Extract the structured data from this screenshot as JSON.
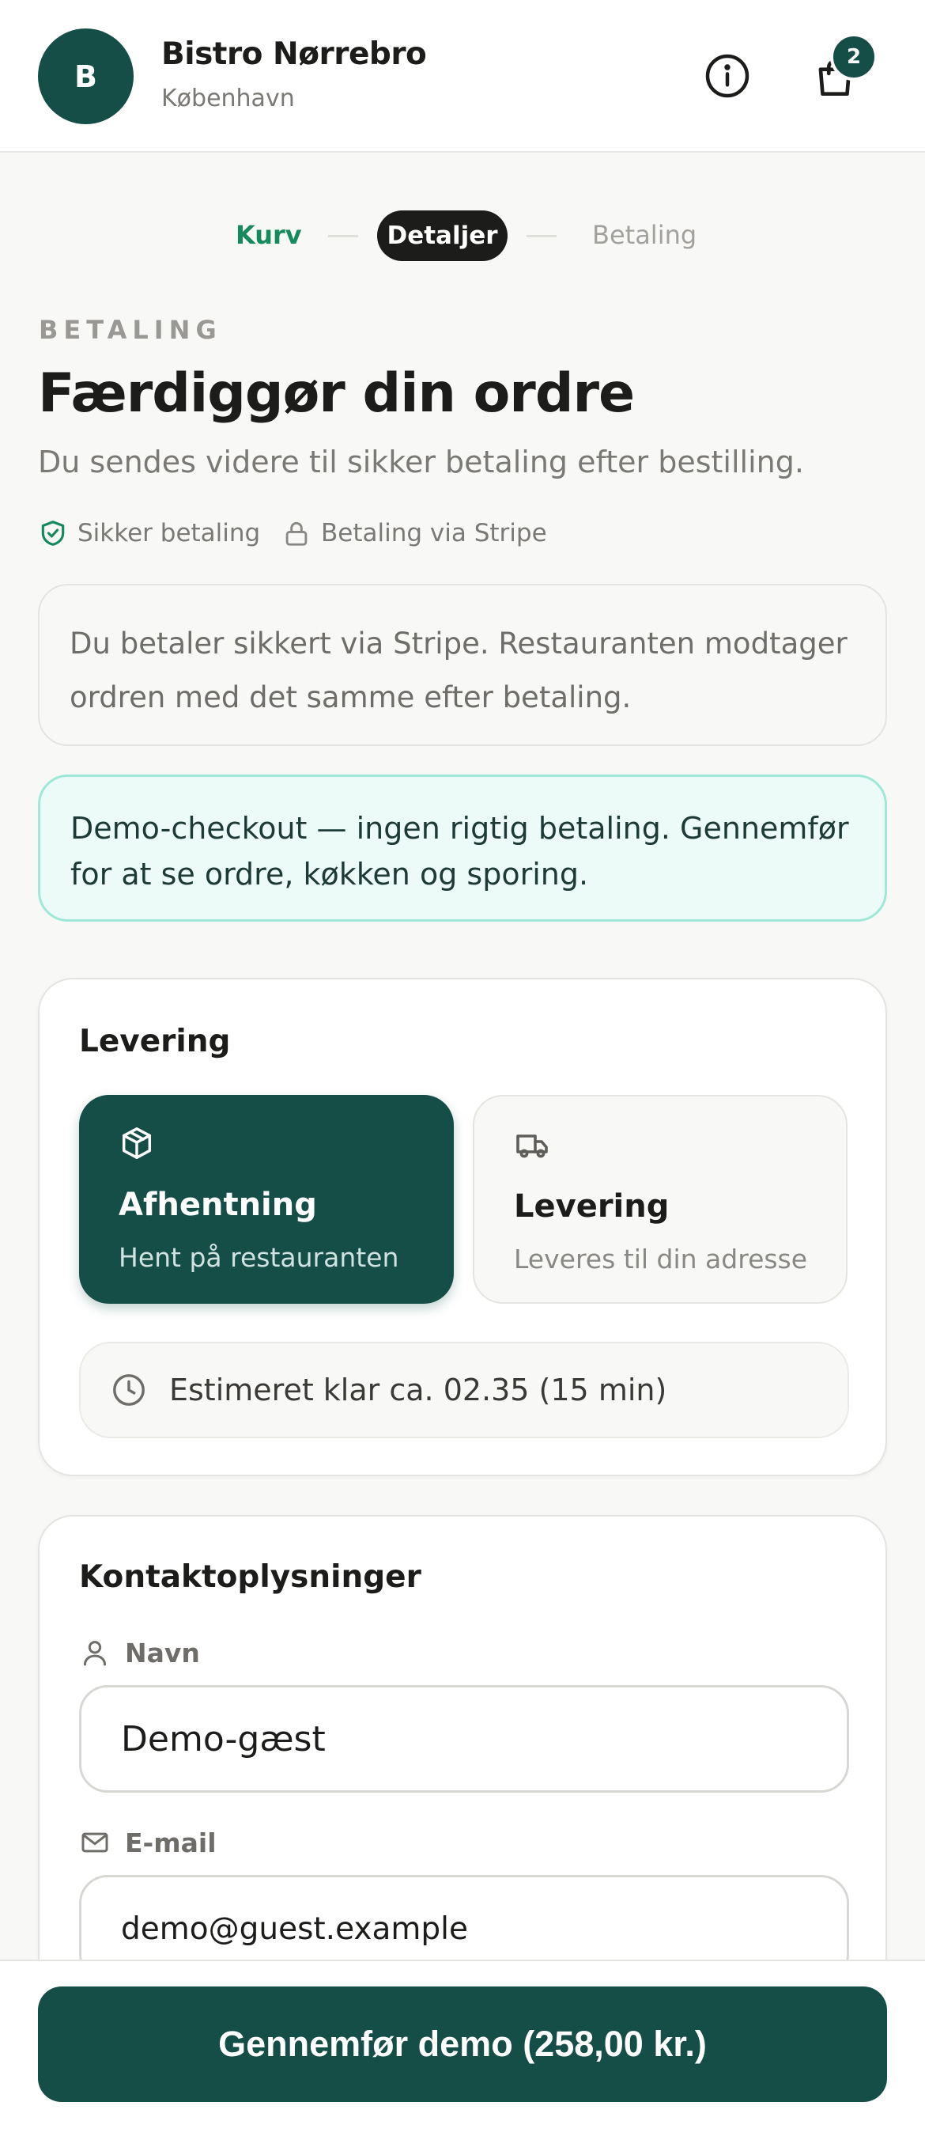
{
  "header": {
    "avatar_letter": "B",
    "name": "Bistro Nørrebro",
    "city": "København",
    "cart_count": "2"
  },
  "steps": [
    {
      "label": "Kurv",
      "state": "done"
    },
    {
      "label": "Detaljer",
      "state": "active"
    },
    {
      "label": "Betaling",
      "state": "upcoming"
    }
  ],
  "hero": {
    "eyebrow": "BETALING",
    "title": "Færdiggør din ordre",
    "subtitle": "Du sendes videre til sikker betaling efter bestilling.",
    "trust_secure": "Sikker betaling",
    "trust_stripe": "Betaling via Stripe"
  },
  "notices": {
    "stripe_info": "Du betaler sikkert via Stripe. Restauranten modtager ordren med det samme efter betaling.",
    "demo_info": "Demo-checkout — ingen rigtig betaling. Gennemfør for at se ordre, køkken og sporing."
  },
  "delivery": {
    "title": "Levering",
    "options": [
      {
        "title": "Afhentning",
        "desc": "Hent på restauranten",
        "selected": true,
        "icon": "package-icon"
      },
      {
        "title": "Levering",
        "desc": "Leveres til din adresse",
        "selected": false,
        "icon": "truck-icon"
      }
    ],
    "eta": "Estimeret klar ca. 02.35 (15 min)"
  },
  "contact": {
    "title": "Kontaktoplysninger",
    "name_label": "Navn",
    "name_value": "Demo-gæst",
    "email_label": "E-mail",
    "email_value": "demo@guest.example"
  },
  "footer": {
    "submit_label": "Gennemfør demo (258,00 kr.)"
  },
  "colors": {
    "brand": "#154d47",
    "accent_green": "#168a5f",
    "demo_bg": "#edfbf8",
    "demo_border": "#9ee8d8"
  }
}
